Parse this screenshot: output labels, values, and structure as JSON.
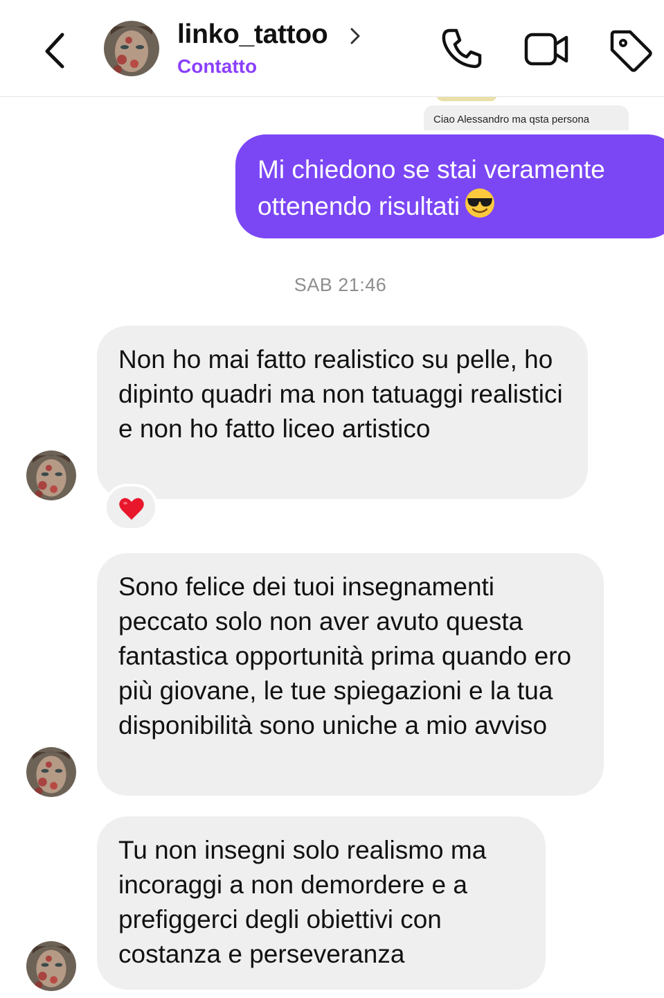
{
  "header": {
    "username": "linko_tattoo",
    "subtitle": "Contatto"
  },
  "shared_preview": {
    "text": "Ciao Alessandro ma qsta persona"
  },
  "messages": {
    "outgoing": {
      "text": "Mi chiedono se stai veramente ottenendo risultati"
    },
    "timestamp": "SAB 21:46",
    "incoming": [
      {
        "text": "Non ho mai fatto realistico su pelle, ho dipinto quadri ma non tatuaggi realistici e non ho fatto liceo artistico",
        "reaction": "red-heart"
      },
      {
        "text": "Sono felice dei tuoi insegnamenti peccato solo non aver avuto questa fantastica opportunità prima quando ero più giovane, le tue spiegazioni e la tua disponibilità sono uniche a mio avviso"
      },
      {
        "text": "Tu non insegni solo realismo ma incoraggi a non demordere e a prefiggerci degli obiettivi con costanza e perseveranza"
      }
    ]
  },
  "icons": {
    "back": "chevron-left-icon",
    "profile_chevron": "chevron-right-icon",
    "call": "phone-icon",
    "video": "video-camera-icon",
    "label": "tag-icon",
    "emoji": "sunglasses-emoji",
    "reaction": "red-heart"
  },
  "colors": {
    "accent": "#8a3ffc",
    "outgoing_bubble": "#7b47f5",
    "incoming_bubble": "#efefef",
    "timestamp": "#8e8e8e"
  }
}
